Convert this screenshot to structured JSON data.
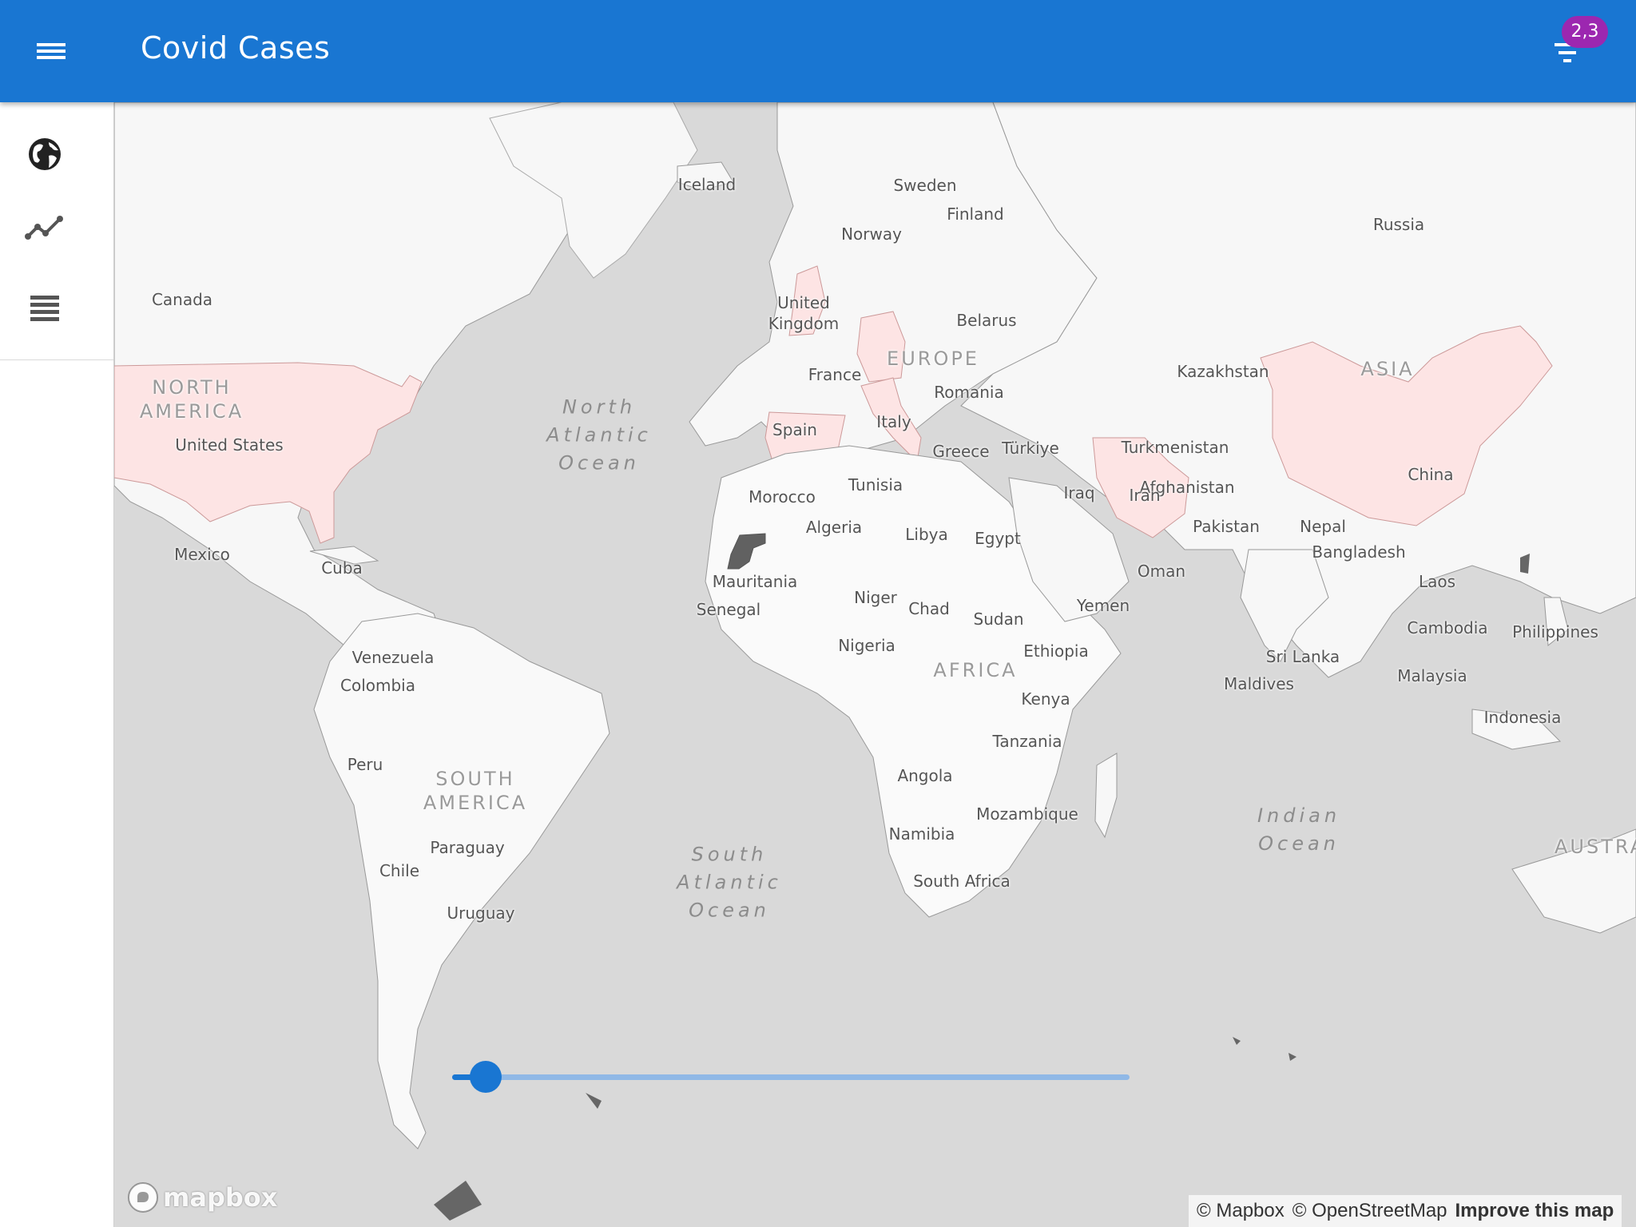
{
  "app": {
    "title": "Covid Cases",
    "filter_badge": "2,3"
  },
  "icons": {
    "menu": "menu-icon",
    "filter": "filter-list-icon",
    "globe": "public-globe-icon",
    "trend": "timeline-icon",
    "list": "view-headline-icon"
  },
  "colors": {
    "appbar": "#1976d2",
    "badge": "#9c27b0",
    "highlight": "#fde4e4",
    "selected_country": "#616161"
  },
  "map": {
    "continents": {
      "north_america": "NORTH\nAMERICA",
      "south_america": "SOUTH\nAMERICA",
      "europe": "EUROPE",
      "africa": "AFRICA",
      "asia": "ASIA",
      "australia": "AUSTRA"
    },
    "oceans": {
      "north_atlantic": "North\nAtlantic\nOcean",
      "south_atlantic": "South\nAtlantic\nOcean",
      "indian": "Indian\nOcean"
    },
    "countries": {
      "iceland": "Iceland",
      "sweden": "Sweden",
      "finland": "Finland",
      "norway": "Norway",
      "russia": "Russia",
      "canada": "Canada",
      "united_kingdom": "United\nKingdom",
      "belarus": "Belarus",
      "france": "France",
      "kazakhstan": "Kazakhstan",
      "romania": "Romania",
      "spain": "Spain",
      "italy": "Italy",
      "united_states": "United States",
      "greece": "Greece",
      "turkiye": "Türkiye",
      "turkmenistan": "Turkmenistan",
      "tunisia": "Tunisia",
      "china": "China",
      "afghanistan": "Afghanistan",
      "iraq": "Iraq",
      "iran": "Iran",
      "morocco": "Morocco",
      "pakistan": "Pakistan",
      "algeria": "Algeria",
      "libya": "Libya",
      "egypt": "Egypt",
      "nepal": "Nepal",
      "mexico": "Mexico",
      "bangladesh": "Bangladesh",
      "cuba": "Cuba",
      "oman": "Oman",
      "mauritania": "Mauritania",
      "laos": "Laos",
      "niger": "Niger",
      "yemen": "Yemen",
      "senegal": "Senegal",
      "chad": "Chad",
      "sudan": "Sudan",
      "cambodia": "Cambodia",
      "philippines": "Philippines",
      "nigeria": "Nigeria",
      "venezuela": "Venezuela",
      "ethiopia": "Ethiopia",
      "sri_lanka": "Sri Lanka",
      "colombia": "Colombia",
      "malaysia": "Malaysia",
      "maldives": "Maldives",
      "kenya": "Kenya",
      "indonesia": "Indonesia",
      "tanzania": "Tanzania",
      "peru": "Peru",
      "angola": "Angola",
      "mozambique": "Mozambique",
      "namibia": "Namibia",
      "paraguay": "Paraguay",
      "chile": "Chile",
      "south_africa": "South Africa",
      "uruguay": "Uruguay"
    }
  },
  "slider": {
    "value_fraction": 0.05
  },
  "attribution": {
    "logo": "mapbox",
    "mapbox": "© Mapbox",
    "osm": "© OpenStreetMap",
    "improve": "Improve this map"
  }
}
